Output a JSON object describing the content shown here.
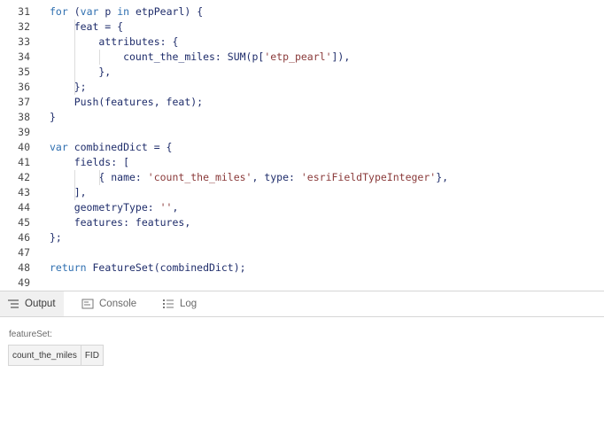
{
  "editor": {
    "lines": [
      {
        "num": "31",
        "tokens": [
          {
            "t": "kw",
            "v": "for"
          },
          {
            "t": "pun",
            "v": " ("
          },
          {
            "t": "kw",
            "v": "var"
          },
          {
            "t": "txt",
            "v": " p "
          },
          {
            "t": "kw",
            "v": "in"
          },
          {
            "t": "txt",
            "v": " etpPearl"
          },
          {
            "t": "pun",
            "v": ") {"
          }
        ]
      },
      {
        "num": "32",
        "tokens": [
          {
            "t": "txt",
            "v": "    feat = {"
          }
        ]
      },
      {
        "num": "33",
        "tokens": [
          {
            "t": "txt",
            "v": "        attributes: {"
          }
        ]
      },
      {
        "num": "34",
        "tokens": [
          {
            "t": "txt",
            "v": "            count_the_miles: SUM(p["
          },
          {
            "t": "str",
            "v": "'etp_pearl'"
          },
          {
            "t": "txt",
            "v": "]),"
          }
        ]
      },
      {
        "num": "35",
        "tokens": [
          {
            "t": "txt",
            "v": "        },"
          }
        ]
      },
      {
        "num": "36",
        "tokens": [
          {
            "t": "txt",
            "v": "    };"
          }
        ]
      },
      {
        "num": "37",
        "tokens": [
          {
            "t": "txt",
            "v": "    Push(features, feat);"
          }
        ]
      },
      {
        "num": "38",
        "tokens": [
          {
            "t": "pun",
            "v": "}"
          }
        ]
      },
      {
        "num": "39",
        "tokens": []
      },
      {
        "num": "40",
        "tokens": [
          {
            "t": "kw",
            "v": "var"
          },
          {
            "t": "txt",
            "v": " combinedDict = {"
          }
        ]
      },
      {
        "num": "41",
        "tokens": [
          {
            "t": "txt",
            "v": "    fields: ["
          }
        ]
      },
      {
        "num": "42",
        "tokens": [
          {
            "t": "txt",
            "v": "        { name: "
          },
          {
            "t": "str",
            "v": "'count_the_miles'"
          },
          {
            "t": "txt",
            "v": ", type: "
          },
          {
            "t": "str",
            "v": "'esriFieldTypeInteger'"
          },
          {
            "t": "txt",
            "v": "},"
          }
        ]
      },
      {
        "num": "43",
        "tokens": [
          {
            "t": "txt",
            "v": "    ],"
          }
        ]
      },
      {
        "num": "44",
        "tokens": [
          {
            "t": "txt",
            "v": "    geometryType: "
          },
          {
            "t": "str",
            "v": "''"
          },
          {
            "t": "txt",
            "v": ","
          }
        ]
      },
      {
        "num": "45",
        "tokens": [
          {
            "t": "txt",
            "v": "    features: features,"
          }
        ]
      },
      {
        "num": "46",
        "tokens": [
          {
            "t": "txt",
            "v": "};"
          }
        ]
      },
      {
        "num": "47",
        "tokens": []
      },
      {
        "num": "48",
        "tokens": [
          {
            "t": "kw",
            "v": "return"
          },
          {
            "t": "txt",
            "v": " FeatureSet(combinedDict);"
          }
        ]
      },
      {
        "num": "49",
        "tokens": []
      }
    ]
  },
  "tabs": {
    "output": "Output",
    "console": "Console",
    "log": "Log",
    "active": "output"
  },
  "output": {
    "label": "featureSet:",
    "fields": [
      "count_the_miles",
      "FID"
    ]
  },
  "colors": {
    "keyword": "#2f6fb0",
    "string": "#8a3a3a",
    "text": "#1f2d6b"
  }
}
